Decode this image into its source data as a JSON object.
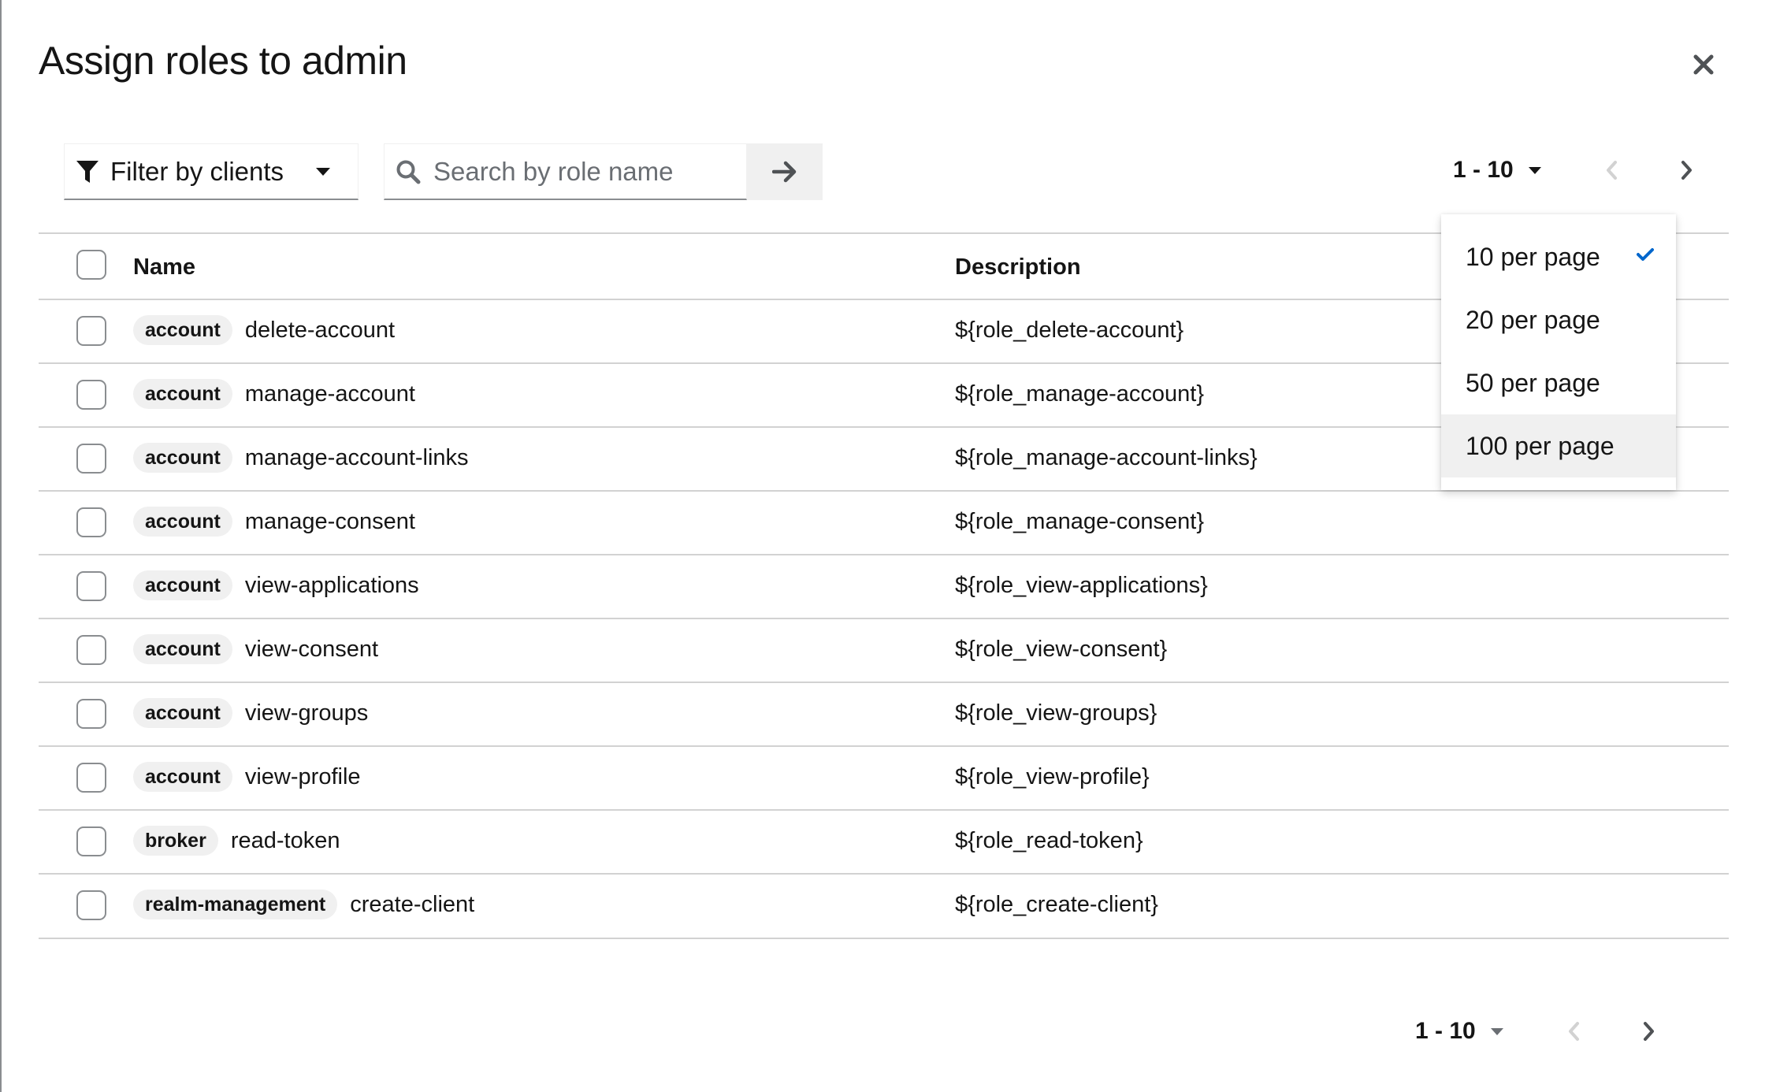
{
  "modal": {
    "title": "Assign roles to admin"
  },
  "toolbar": {
    "filter_label": "Filter by clients",
    "search_placeholder": "Search by role name",
    "search_value": ""
  },
  "pagination": {
    "range": "1 - 10"
  },
  "per_page_menu": {
    "options": [
      "10 per page",
      "20 per page",
      "50 per page",
      "100 per page"
    ],
    "selected": "10 per page",
    "hovered": "100 per page"
  },
  "table": {
    "columns": [
      "Name",
      "Description"
    ],
    "rows": [
      {
        "client": "account",
        "role": "delete-account",
        "description": "${role_delete-account}"
      },
      {
        "client": "account",
        "role": "manage-account",
        "description": "${role_manage-account}"
      },
      {
        "client": "account",
        "role": "manage-account-links",
        "description": "${role_manage-account-links}"
      },
      {
        "client": "account",
        "role": "manage-consent",
        "description": "${role_manage-consent}"
      },
      {
        "client": "account",
        "role": "view-applications",
        "description": "${role_view-applications}"
      },
      {
        "client": "account",
        "role": "view-consent",
        "description": "${role_view-consent}"
      },
      {
        "client": "account",
        "role": "view-groups",
        "description": "${role_view-groups}"
      },
      {
        "client": "account",
        "role": "view-profile",
        "description": "${role_view-profile}"
      },
      {
        "client": "broker",
        "role": "read-token",
        "description": "${role_read-token}"
      },
      {
        "client": "realm-management",
        "role": "create-client",
        "description": "${role_create-client}"
      }
    ]
  },
  "colors": {
    "check_accent": "#0066cc",
    "border": "#d2d2d2",
    "badge_bg": "#f0f0f0",
    "disabled_icon": "#d2d2d2"
  }
}
